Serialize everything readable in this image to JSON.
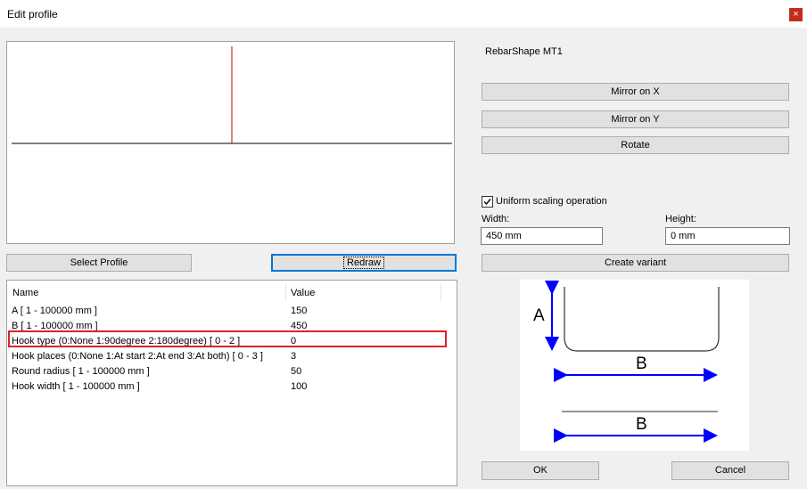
{
  "window": {
    "title": "Edit profile",
    "close_glyph": "×"
  },
  "shape_name": "RebarShape MT1",
  "buttons": {
    "select_profile": "Select Profile",
    "redraw": "Redraw",
    "mirror_x": "Mirror on X",
    "mirror_y": "Mirror on Y",
    "rotate": "Rotate",
    "create_variant": "Create variant",
    "ok": "OK",
    "cancel": "Cancel"
  },
  "scaling": {
    "uniform_label": "Uniform scaling operation",
    "uniform_checked": true,
    "width_label": "Width:",
    "width_value": "450 mm",
    "height_label": "Height:",
    "height_value": "0 mm"
  },
  "grid": {
    "columns": [
      "Name",
      "Value"
    ],
    "rows": [
      {
        "name": "A [ 1 - 100000 mm ]",
        "value": "150"
      },
      {
        "name": "B [ 1 - 100000 mm ]",
        "value": "450"
      },
      {
        "name": "Hook type (0:None 1:90degree 2:180degree) [ 0 - 2 ]",
        "value": "0"
      },
      {
        "name": "Hook places (0:None 1:At start 2:At end 3:At both) [ 0 - 3 ]",
        "value": "3"
      },
      {
        "name": "Round radius [ 1 - 100000 mm ]",
        "value": "50"
      },
      {
        "name": "Hook width [ 1 - 100000 mm ]",
        "value": "100"
      }
    ]
  },
  "diagram": {
    "label_a": "A",
    "label_b1": "B",
    "label_b2": "B"
  },
  "colors": {
    "highlight": "#e0202a",
    "arrow": "#0000ff",
    "preview_vertical": "#c00000"
  }
}
